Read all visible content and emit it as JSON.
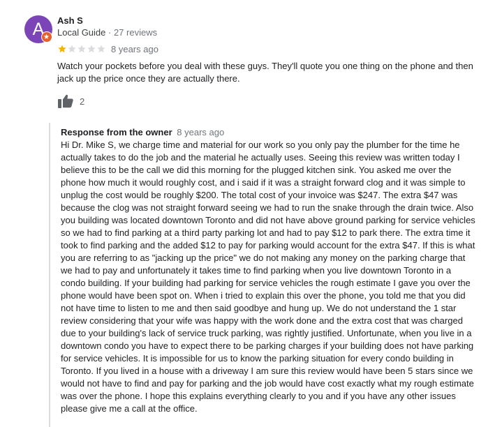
{
  "reviewer": {
    "initial": "A",
    "name": "Ash S",
    "guide_label": "Local Guide",
    "review_count": "· 27 reviews"
  },
  "rating": {
    "stars": 1,
    "out_of": 5,
    "age": "8 years ago"
  },
  "review_text": "Watch your pockets before you deal with these guys. They'll quote you one thing on the phone and then jack up the price once they are actually there.",
  "likes": "2",
  "owner_response": {
    "label": "Response from the owner",
    "age": "8 years ago",
    "text": "Hi Dr. Mike S, we charge time and material for our work so you only pay the plumber for the time he actually takes to do the job and the material he actually uses. Seeing this review was written today I believe this to be the call we did this morning for the plugged kitchen sink. You asked me over the phone how much it would roughly cost, and i said if it was a straight forward clog and it was simple to unplug the cost would be roughly $200. The total cost of your invoice was $247. The extra $47 was because the clog was not straight forward seeing we had to run the snake through the drain twice. Also you building was located downtown Toronto and did not have above ground parking for service vehicles so we had to find parking at a third party parking lot and had to pay $12 to park there. The extra time it took to find parking and the added $12 to pay for parking would account for the extra $47. If this is what you are referring to as \"jacking up the price\" we do not making any money on the parking charge that we had to pay and unfortunately it takes time to find parking when you live downtown Toronto in a condo building. If your building had parking for service vehicles the rough estimate I gave you over the phone would have been spot on. When i tried to explain this over the phone, you told me that you did not have time to listen to me and then said goodbye and hung up. We do not understand the 1 star review considering that your wife was happy with the work done and the extra cost that was charged due to your building's lack of service truck parking, was rightly justified. Unfortunate, when you live in a downtown condo you have to expect there to be parking charges if your building does not have parking for service vehicles. It is impossible for us to know the parking situation for every condo building in Toronto. If you lived in a house with a driveway I am sure this review would have been 5 stars since we would not have to find and pay for parking and the job would have cost exactly what my rough estimate was over the phone. I hope this explains everything clearly to you and if you have any other issues please give me a call at the office."
  },
  "colors": {
    "avatar": "#7b45b8",
    "badge": "#e8602c",
    "star_filled": "#f4b400",
    "star_empty": "#dadce0"
  },
  "icons": {
    "badge": "local-guide-badge-icon",
    "like": "thumbs-up-icon",
    "star": "star-icon"
  }
}
